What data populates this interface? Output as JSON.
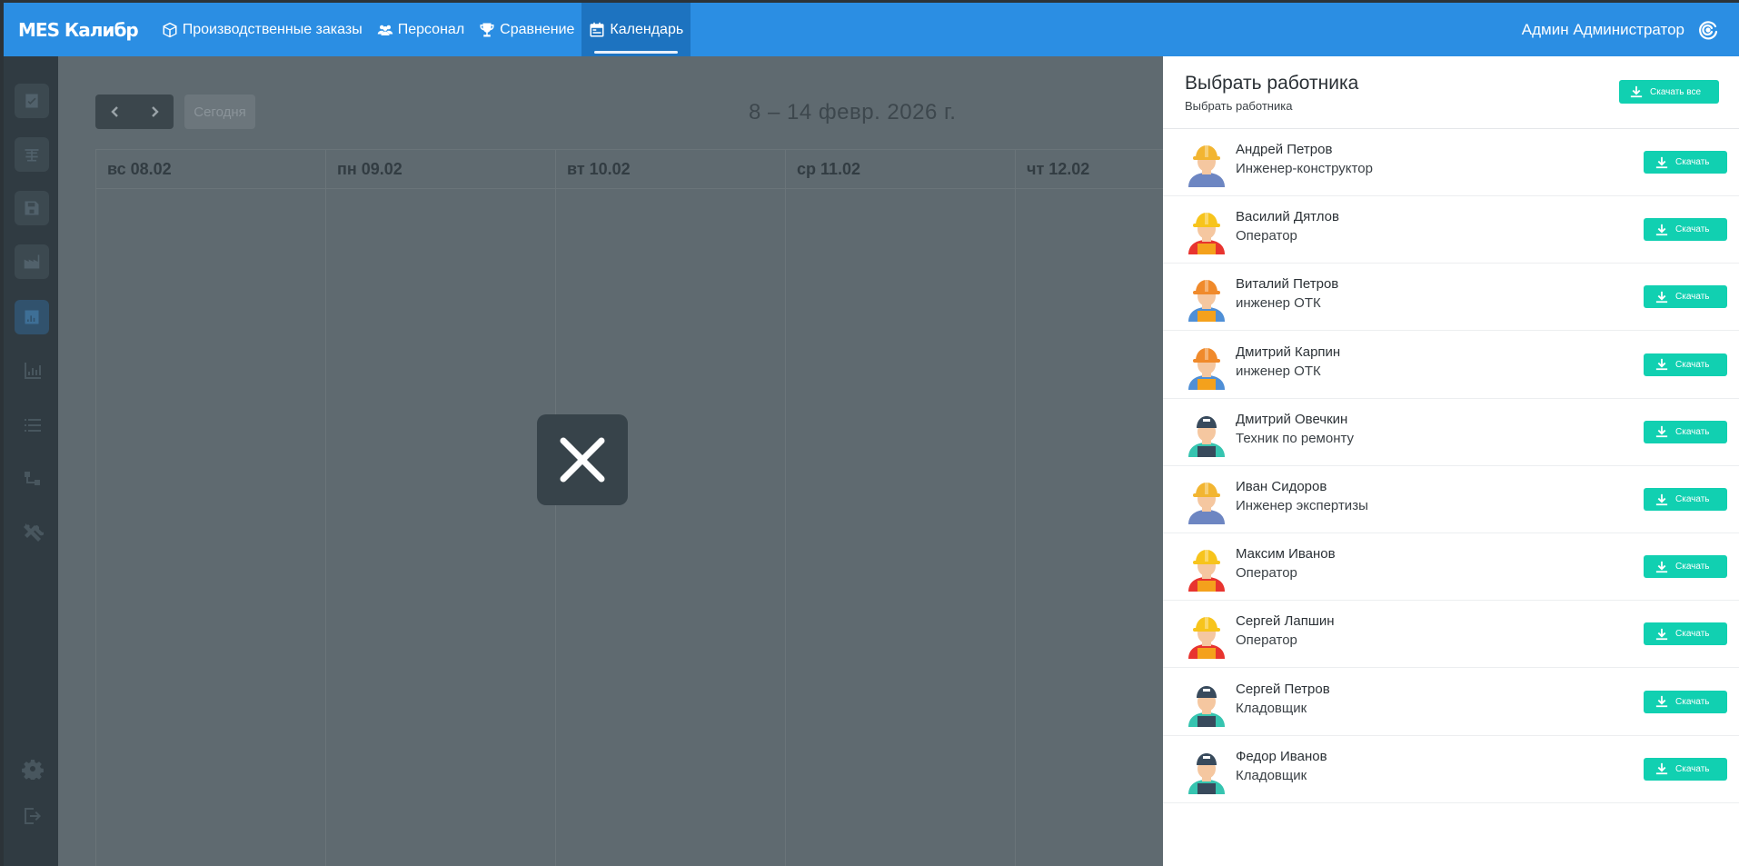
{
  "header": {
    "brand": "MES Калибр",
    "nav": [
      {
        "label": "Производственные заказы",
        "icon": "box-icon"
      },
      {
        "label": "Персонал",
        "icon": "users-icon"
      },
      {
        "label": "Сравнение",
        "icon": "trophy-icon"
      },
      {
        "label": "Календарь",
        "icon": "calendar-icon",
        "active": true
      }
    ],
    "user": "Админ Администратор"
  },
  "calendar": {
    "today_label": "Сегодня",
    "title": "8 – 14 февр. 2026 г.",
    "days": [
      "вс 08.02",
      "пн 09.02",
      "вт 10.02",
      "ср 11.02",
      "чт 12.02"
    ]
  },
  "panel": {
    "title": "Выбрать работника",
    "subtitle": "Выбрать работника",
    "download_all_label": "Скачать все",
    "download_label": "Скачать",
    "workers": [
      {
        "name": "Андрей Петров",
        "role": "Инженер-конструктор",
        "avatar": "engineer-blue"
      },
      {
        "name": "Василий Дятлов",
        "role": "Оператор",
        "avatar": "operator-red"
      },
      {
        "name": "Виталий Петров",
        "role": "инженер ОТК",
        "avatar": "inspector-orange"
      },
      {
        "name": "Дмитрий Карпин",
        "role": "инженер ОТК",
        "avatar": "inspector-orange"
      },
      {
        "name": "Дмитрий Овечкин",
        "role": "Техник по ремонту",
        "avatar": "technician-teal"
      },
      {
        "name": "Иван Сидоров",
        "role": "Инженер экспертизы",
        "avatar": "engineer-blue"
      },
      {
        "name": "Максим Иванов",
        "role": "Оператор",
        "avatar": "operator-red"
      },
      {
        "name": "Сергей Лапшин",
        "role": "Оператор",
        "avatar": "operator-red"
      },
      {
        "name": "Сергей Петров",
        "role": "Кладовщик",
        "avatar": "technician-teal"
      },
      {
        "name": "Федор Иванов",
        "role": "Кладовщик",
        "avatar": "technician-teal"
      }
    ]
  },
  "colors": {
    "topbar": "#2b8ee3",
    "accent": "#11d0b1",
    "sidebar": "#303b42",
    "overlay": "#5f6a70"
  }
}
